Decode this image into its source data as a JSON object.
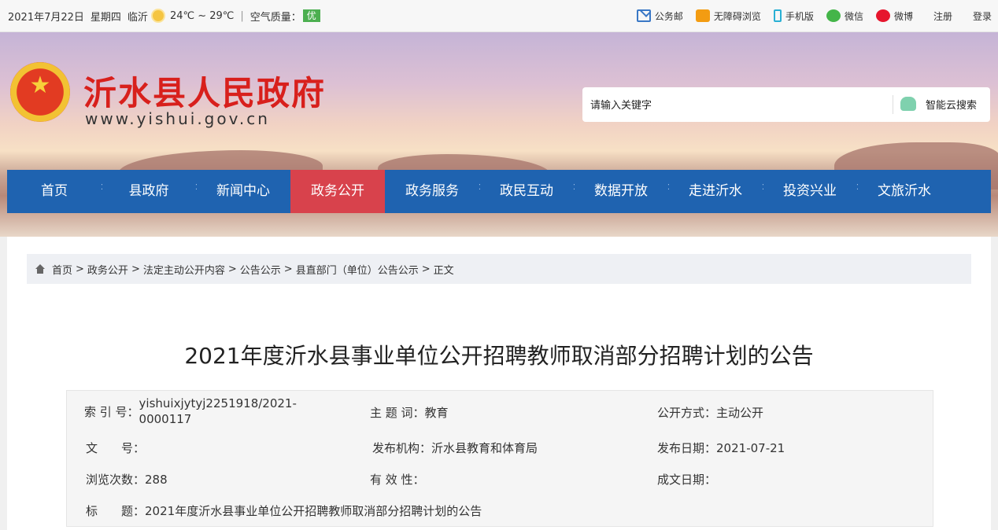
{
  "topbar": {
    "date": "2021年7月22日",
    "weekday": "星期四",
    "city": "临沂",
    "weather_icon": "sun-icon",
    "temperature": "24℃ ~ 29℃",
    "separator": "|",
    "air_quality_label": "空气质量：",
    "air_quality_value": "优",
    "links": [
      {
        "label": "公务邮",
        "icon": "mail-icon"
      },
      {
        "label": "无障碍浏览",
        "icon": "accessibility-icon"
      },
      {
        "label": "手机版",
        "icon": "mobile-icon"
      },
      {
        "label": "微信",
        "icon": "wechat-icon"
      },
      {
        "label": "微博",
        "icon": "weibo-icon"
      },
      {
        "label": "注册",
        "icon": ""
      },
      {
        "label": "登录",
        "icon": ""
      }
    ]
  },
  "header": {
    "site_title": "沂水县人民政府",
    "site_url": "www.yishui.gov.cn"
  },
  "search": {
    "placeholder": "请输入关键字",
    "button_label": "智能云搜索"
  },
  "nav": {
    "items": [
      {
        "label": "首页",
        "active": false
      },
      {
        "label": "县政府",
        "active": false
      },
      {
        "label": "新闻中心",
        "active": false
      },
      {
        "label": "政务公开",
        "active": true
      },
      {
        "label": "政务服务",
        "active": false
      },
      {
        "label": "政民互动",
        "active": false
      },
      {
        "label": "数据开放",
        "active": false
      },
      {
        "label": "走进沂水",
        "active": false
      },
      {
        "label": "投资兴业",
        "active": false
      },
      {
        "label": "文旅沂水",
        "active": false
      }
    ]
  },
  "breadcrumb": {
    "items": [
      "首页",
      "政务公开",
      "法定主动公开内容",
      "公告公示",
      "县直部门（单位）公告公示",
      "正文"
    ],
    "separator": ">"
  },
  "article": {
    "title": "2021年度沂水县事业单位公开招聘教师取消部分招聘计划的公告"
  },
  "meta": {
    "index_label": "索 引 号：",
    "index_value_1": "yishuixjytyj2251918/2021-",
    "index_value_2": "0000117",
    "subject_label": "主 题 词：",
    "subject_value": "教育",
    "open_method_label": "公开方式：",
    "open_method_value": "主动公开",
    "doc_no_label": "文　　号：",
    "doc_no_value": "",
    "publisher_label": "发布机构：",
    "publisher_value": "沂水县教育和体育局",
    "publish_date_label": "发布日期：",
    "publish_date_value": "2021-07-21",
    "views_label": "浏览次数：",
    "views_value": "288",
    "validity_label": "有 效 性：",
    "validity_value": "",
    "created_label": "成文日期：",
    "created_value": "",
    "title_label": "标　　题：",
    "title_value": "2021年度沂水县事业单位公开招聘教师取消部分招聘计划的公告"
  },
  "colors": {
    "nav_bg": "#1f63b0",
    "nav_active": "#d8424c",
    "site_title": "#d8201c",
    "air_quality_badge": "#4caf50"
  }
}
